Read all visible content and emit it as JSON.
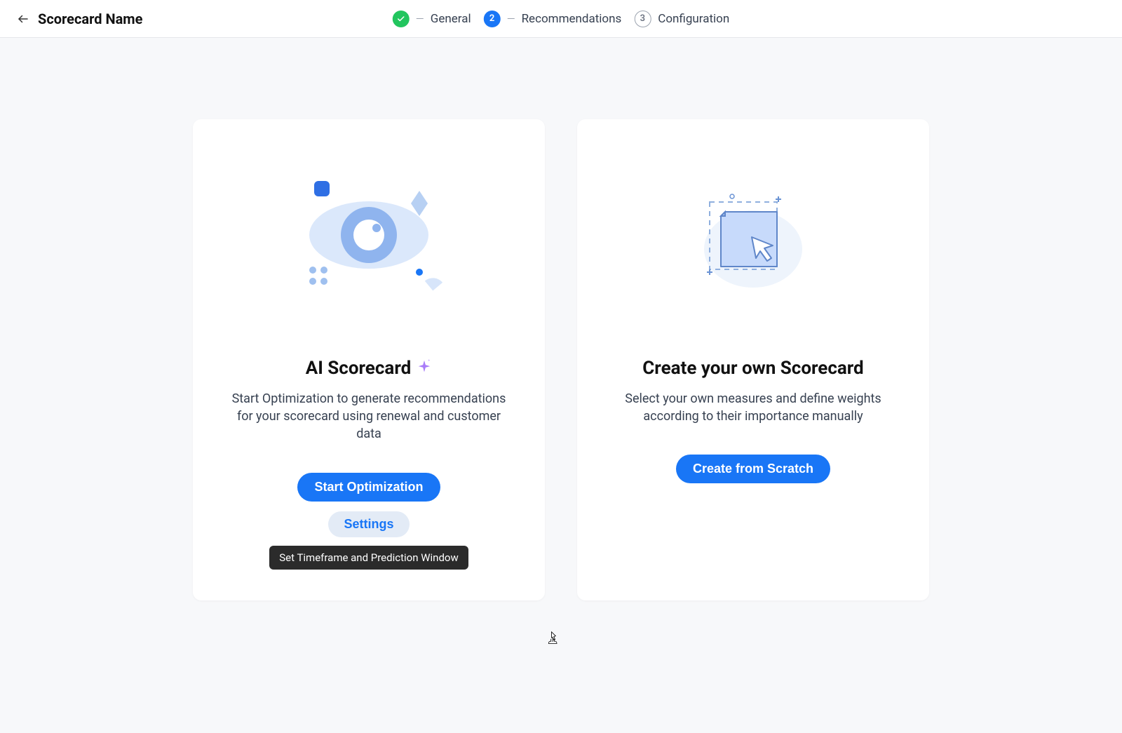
{
  "header": {
    "title": "Scorecard Name"
  },
  "stepper": {
    "steps": [
      {
        "label": "General",
        "status": "done"
      },
      {
        "label": "Recommendations",
        "status": "active",
        "number": "2"
      },
      {
        "label": "Configuration",
        "status": "pending",
        "number": "3"
      }
    ]
  },
  "cards": {
    "ai": {
      "title": "AI Scorecard",
      "desc": "Start Optimization to generate recommendations for your scorecard using renewal and customer data",
      "primary_button": "Start Optimization",
      "secondary_button": "Settings",
      "tooltip": "Set Timeframe and Prediction Window"
    },
    "manual": {
      "title": "Create your own Scorecard",
      "desc": "Select your own measures and define weights according to their importance manually",
      "primary_button": "Create from Scratch"
    }
  }
}
